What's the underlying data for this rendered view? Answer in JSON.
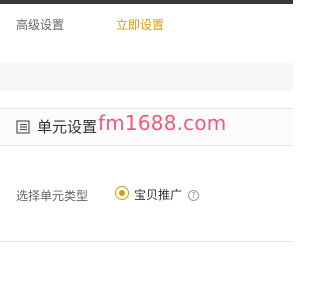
{
  "advanced": {
    "label": "高级设置",
    "link": "立即设置"
  },
  "section": {
    "title": "单元设置",
    "icon": "document-list-icon"
  },
  "watermark": "fm1688.com",
  "unit_type": {
    "label": "选择单元类型",
    "option": "宝贝推广",
    "selected": true,
    "help_icon": "question-circle-icon"
  },
  "colors": {
    "accent": "#e19a00",
    "watermark": "#f05a7a",
    "gap": "#f7f7f7"
  }
}
